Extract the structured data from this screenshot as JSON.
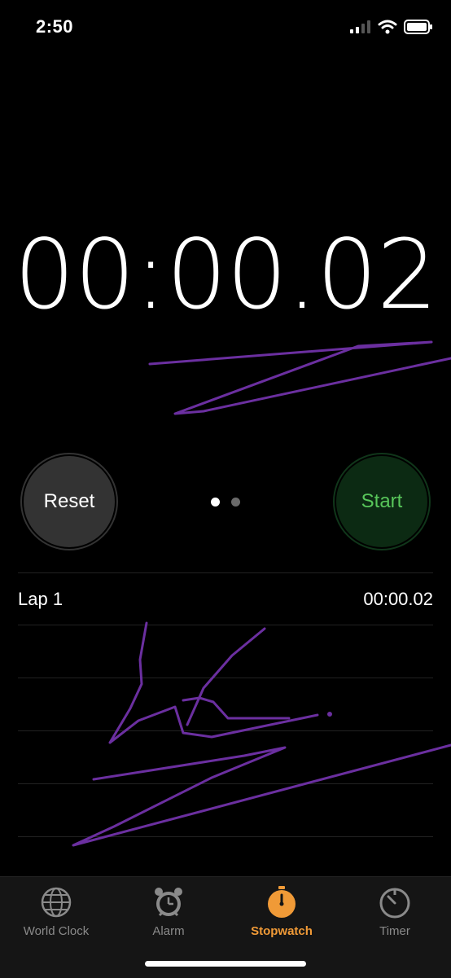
{
  "status_bar": {
    "time": "2:50",
    "icons": [
      "signal-icon",
      "wifi-icon",
      "battery-icon"
    ]
  },
  "stopwatch": {
    "display": "00:00.02",
    "reset_label": "Reset",
    "start_label": "Start",
    "pages": [
      {
        "active": true
      },
      {
        "active": false
      }
    ]
  },
  "laps": [
    {
      "label": "Lap 1",
      "time": "00:00.02"
    }
  ],
  "tabs": [
    {
      "label": "World Clock",
      "icon": "globe-icon",
      "active": false
    },
    {
      "label": "Alarm",
      "icon": "alarm-clock-icon",
      "active": false
    },
    {
      "label": "Stopwatch",
      "icon": "stopwatch-icon",
      "active": true
    },
    {
      "label": "Timer",
      "icon": "timer-icon",
      "active": false
    }
  ],
  "colors": {
    "accent": "#f09a37",
    "start_text": "#58c65a",
    "start_bg": "#0c2a13",
    "reset_bg": "#333333",
    "scribble": "#6b2fa0"
  }
}
